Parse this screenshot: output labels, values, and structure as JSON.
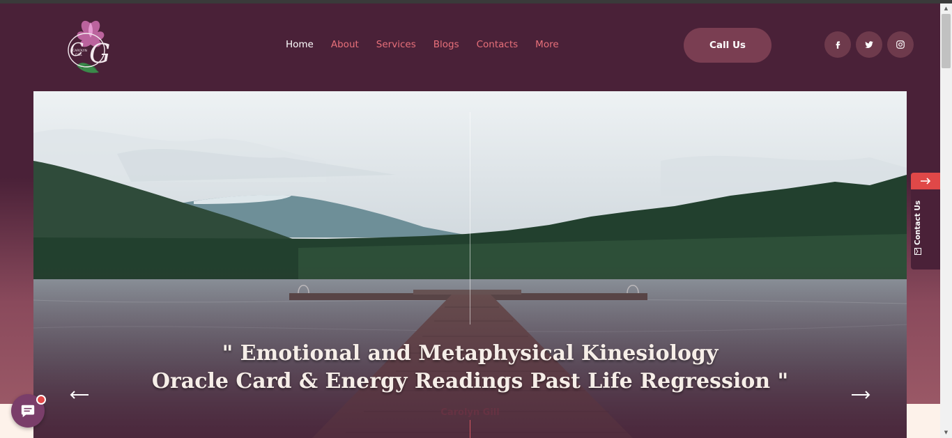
{
  "header": {
    "logo_text": "Carolyn Gill",
    "nav": [
      {
        "label": "Home",
        "active": true
      },
      {
        "label": "About"
      },
      {
        "label": "Services"
      },
      {
        "label": "Blogs"
      },
      {
        "label": "Contacts"
      },
      {
        "label": "More"
      }
    ],
    "call_button": "Call Us",
    "social": [
      "facebook-icon",
      "twitter-icon",
      "instagram-icon"
    ]
  },
  "hero": {
    "line1": "\" Emotional and Metaphysical Kinesiology",
    "line2": "Oracle Card & Energy Readings Past Life Regression \"",
    "subtitle": "Carolyn Gill",
    "prev_arrow": "arrow-left-icon",
    "next_arrow": "arrow-right-icon"
  },
  "side_tab": {
    "label": "Contact Us",
    "arrow": "arrow-right-icon"
  },
  "chat": {
    "icon": "chat-icon",
    "has_notification": true
  },
  "colors": {
    "background": "#4a2138",
    "accent": "#e8707a",
    "button": "#7a3e52",
    "alert": "#e04848"
  }
}
